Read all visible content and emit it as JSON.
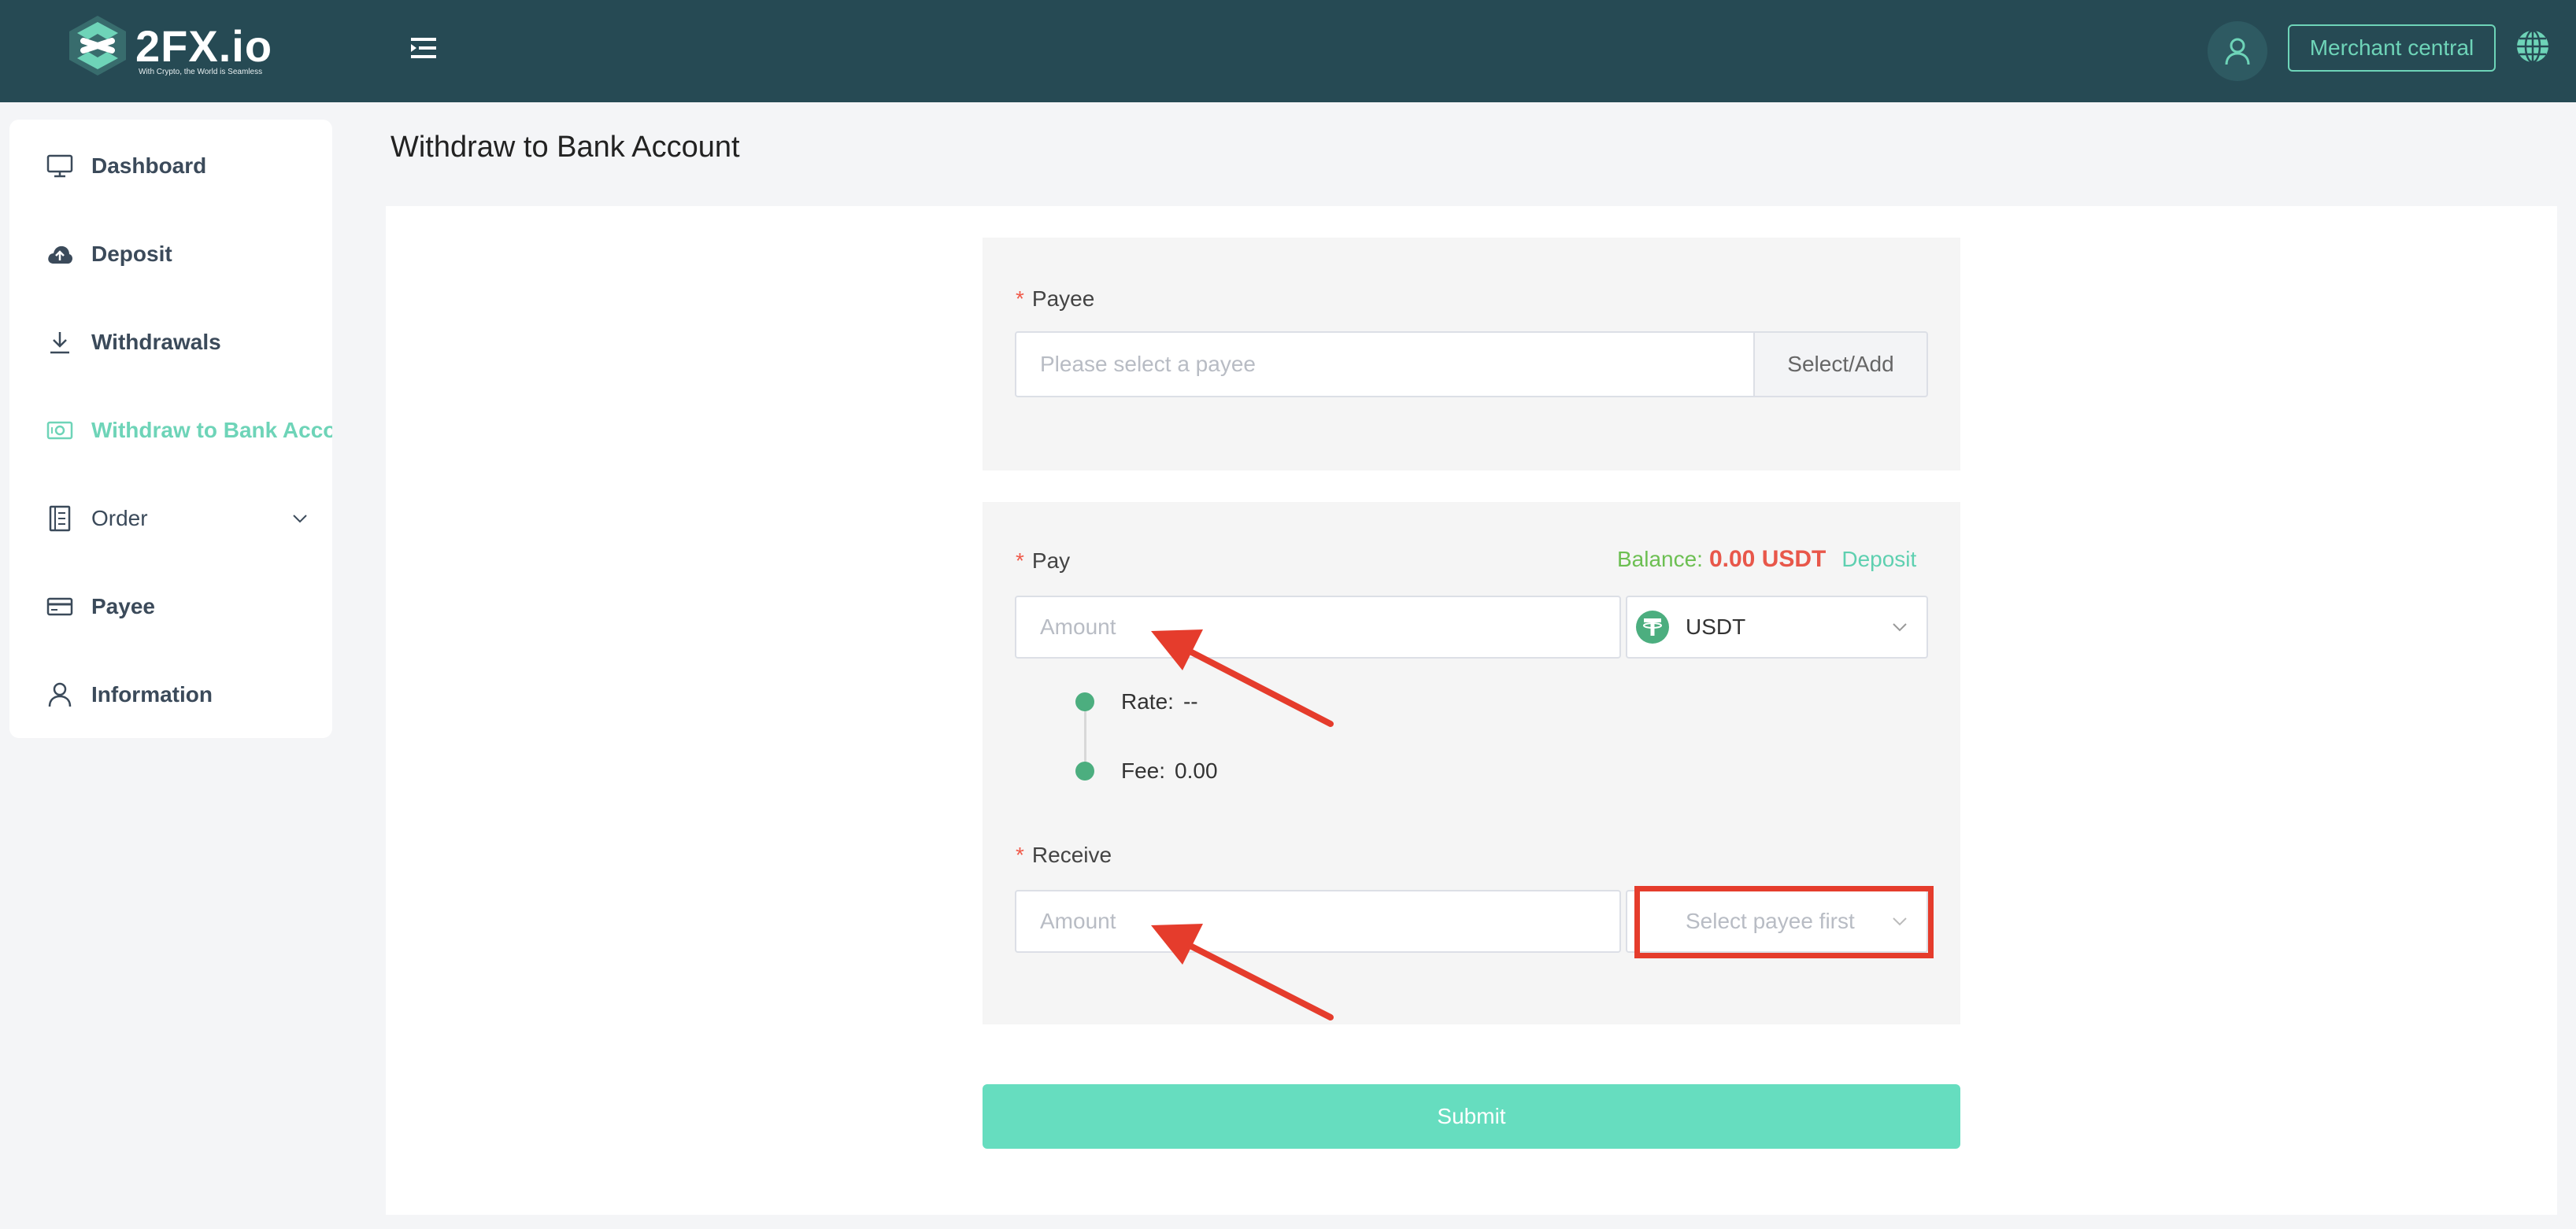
{
  "header": {
    "logo": {
      "name": "2FX.io",
      "tagline": "With Crypto, the World is Seamless"
    },
    "merchant_button": "Merchant central",
    "colors": {
      "bar": "#264a54",
      "accent": "#6ed4b8"
    }
  },
  "sidebar": {
    "items": [
      {
        "label": "Dashboard",
        "icon": "monitor-icon"
      },
      {
        "label": "Deposit",
        "icon": "cloud-upload-icon"
      },
      {
        "label": "Withdrawals",
        "icon": "download-icon"
      },
      {
        "label": "Withdraw to Bank Acco",
        "icon": "banknote-icon",
        "active": true
      },
      {
        "label": "Order",
        "icon": "document-list-icon",
        "expandable": true
      },
      {
        "label": "Payee",
        "icon": "credit-card-icon"
      },
      {
        "label": "Information",
        "icon": "user-icon"
      }
    ]
  },
  "page": {
    "title": "Withdraw to Bank Account"
  },
  "form": {
    "payee": {
      "label": "Payee",
      "required_mark": "*",
      "placeholder": "Please select a payee",
      "addon": "Select/Add"
    },
    "pay": {
      "label": "Pay",
      "required_mark": "*",
      "placeholder": "Amount",
      "currency": "USDT",
      "currency_icon": "tether-icon",
      "balance_label": "Balance:",
      "balance_value": "0.00 USDT",
      "deposit_link": "Deposit"
    },
    "details": {
      "rate_label": "Rate:",
      "rate_value": "--",
      "fee_label": "Fee:",
      "fee_value": "0.00"
    },
    "receive": {
      "label": "Receive",
      "required_mark": "*",
      "placeholder": "Amount",
      "currency_placeholder": "Select payee first"
    },
    "submit": "Submit"
  },
  "annotations": {
    "color": "#e53c2c"
  }
}
